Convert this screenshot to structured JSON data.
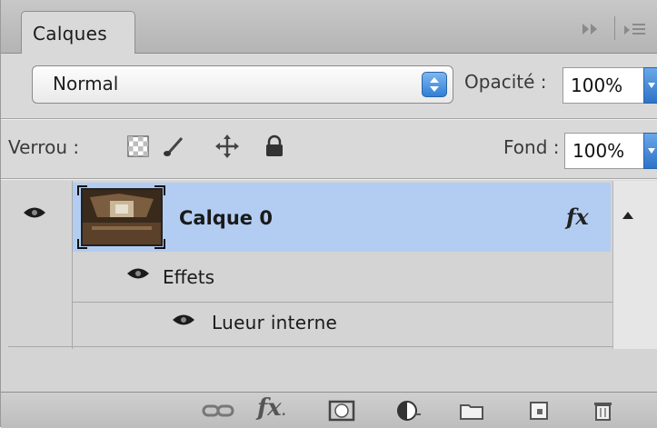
{
  "panel": {
    "tab_label": "Calques"
  },
  "blend": {
    "mode": "Normal",
    "opacity_label": "Opacité :",
    "opacity_value": "100%"
  },
  "lock": {
    "label": "Verrou :",
    "fill_label": "Fond :",
    "fill_value": "100%"
  },
  "layers": {
    "layer_name": "Calque 0",
    "fx_label": "fx",
    "effects_label": "Effets",
    "effect_name": "Lueur interne"
  },
  "colors": {
    "selection": "#b3cdf2",
    "accent": "#2f7fd6"
  }
}
